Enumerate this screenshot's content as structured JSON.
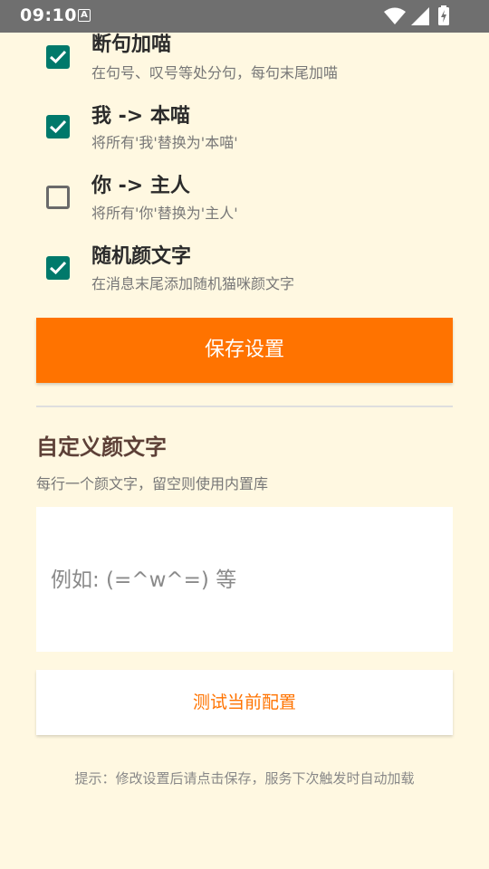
{
  "status_bar": {
    "time": "09:10",
    "notification_letter": "A",
    "icons": [
      "wifi-icon",
      "cell-signal-icon",
      "battery-charging-icon"
    ]
  },
  "settings": [
    {
      "title": "断句加喵",
      "description": "在句号、叹号等处分句，每句末尾加喵",
      "checked": true
    },
    {
      "title": "我 -> 本喵",
      "description": "将所有'我'替换为'本喵'",
      "checked": true
    },
    {
      "title": "你 -> 主人",
      "description": "将所有'你'替换为'主人'",
      "checked": false
    },
    {
      "title": "随机颜文字",
      "description": "在消息末尾添加随机猫咪颜文字",
      "checked": true
    }
  ],
  "save_button": {
    "label": "保存设置"
  },
  "custom_kaomoji": {
    "title": "自定义颜文字",
    "description": "每行一个颜文字，留空则使用内置库",
    "placeholder": "例如: (=^w^=) 等",
    "value": ""
  },
  "test_button": {
    "label": "测试当前配置"
  },
  "hint": "提示：修改设置后请点击保存，服务下次触发时自动加载",
  "colors": {
    "background": "#FFF8E1",
    "accent": "#FF7300",
    "checkbox": "#00796B",
    "section_title": "#5D4037"
  }
}
